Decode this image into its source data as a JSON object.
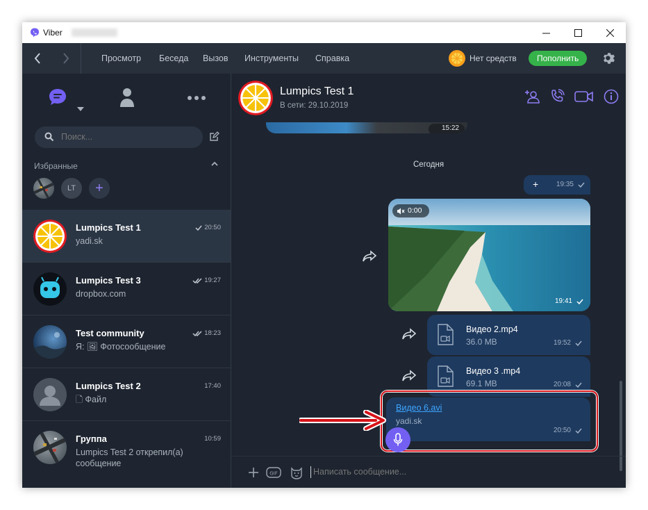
{
  "window": {
    "app_title": "Viber",
    "minimize_icon": "minimize-icon",
    "maximize_icon": "maximize-icon",
    "close_icon": "close-icon"
  },
  "menubar": {
    "items": [
      "Просмотр",
      "Беседа",
      "Вызов",
      "Инструменты",
      "Справка"
    ],
    "balance_text": "Нет средств",
    "topup_label": "Пополнить"
  },
  "sidebar": {
    "search_placeholder": "Поиск...",
    "favorites_label": "Избранные",
    "favorites": [
      {
        "initials": ""
      },
      {
        "initials": "LT"
      },
      {
        "initials": "+"
      }
    ],
    "chats": [
      {
        "name": "Lumpics Test 1",
        "preview": "yadi.sk",
        "time": "20:50",
        "status": "sent",
        "active": true
      },
      {
        "name": "Lumpics Test 3",
        "preview": "dropbox.com",
        "time": "19:27",
        "status": "read",
        "active": false
      },
      {
        "name": "Test community",
        "preview": "Я: 🖼 Фотосообщение",
        "time": "18:23",
        "status": "read",
        "active": false
      },
      {
        "name": "Lumpics Test 2",
        "preview": "🗋 Файл",
        "time": "17:40",
        "status": "",
        "active": false
      },
      {
        "name": "Группа",
        "preview": "Lumpics Test 2 открепил(а) сообщение",
        "time": "10:59",
        "status": "",
        "active": false
      }
    ]
  },
  "chat": {
    "name": "Lumpics Test 1",
    "status": "В сети: 29.10.2019",
    "date_separator": "Сегодня",
    "prev_time": "15:22",
    "messages": {
      "plus": {
        "text": "+",
        "time": "19:35"
      },
      "video": {
        "duration": "0:00",
        "time": "19:41"
      },
      "file1": {
        "name": "Видео 2.mp4",
        "size": "36.0 MB",
        "time": "19:52"
      },
      "file2": {
        "name": "Видео 3 .mp4",
        "size": "69.1 MB",
        "time": "20:08"
      },
      "link": {
        "title": "Видео 6.avi",
        "domain": "yadi.sk",
        "time": "20:50"
      }
    },
    "composer_placeholder": "Написать сообщение...",
    "colors": {
      "accent": "#7360f2",
      "bubble": "#1e3a5f",
      "highlight": "#d7141a"
    }
  }
}
